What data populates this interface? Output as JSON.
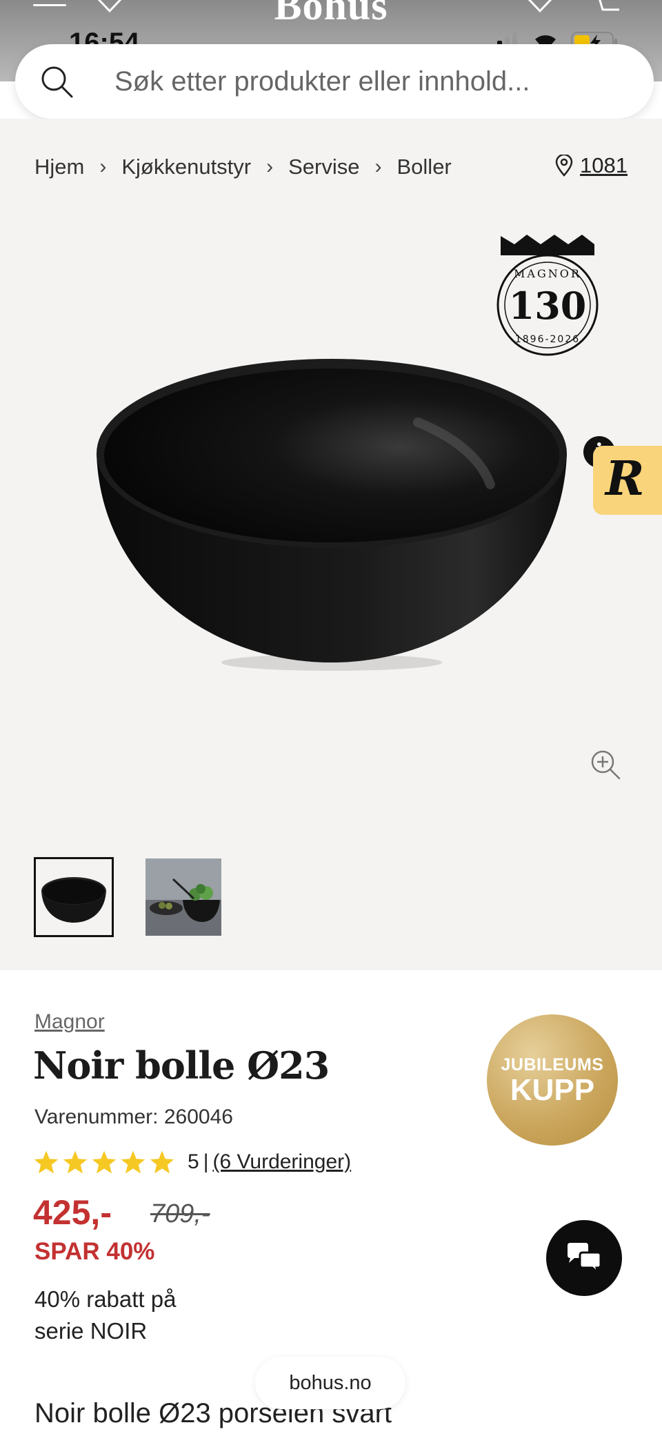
{
  "app": {
    "brand": "Bohus"
  },
  "status_bar": {
    "time": "16:54"
  },
  "search": {
    "placeholder": "Søk etter produkter eller innhold..."
  },
  "breadcrumb": {
    "items": [
      "Hjem",
      "Kjøkkenutstyr",
      "Servise",
      "Boller"
    ]
  },
  "store": {
    "label": "1081"
  },
  "badge": {
    "brand": "MAGNOR",
    "number": "130",
    "years": "1896-2026"
  },
  "product": {
    "brand": "Magnor",
    "title": "Noir bolle Ø23",
    "sku": "Varenummer: 260046",
    "rating_score": "5",
    "rating_separator": "|",
    "reviews": "(6 Vurderinger)",
    "stars": 5,
    "price": "425,-",
    "old_price": "709,-",
    "save": "SPAR 40%",
    "promo": "40% rabatt på serie NOIR",
    "description_start": "Noir bolle Ø23 porselen svart"
  },
  "kupp_badge": {
    "line1": "JUBILEUMS",
    "line2": "KUPP"
  },
  "site_pill": {
    "label": "bohus.no"
  },
  "colors": {
    "price_red": "#c33131",
    "star_yellow": "#f6c823",
    "gallery_bg": "#f4f3f2",
    "r_tab": "#f9d47a",
    "kupp_gold": "#c9a45a"
  },
  "icons": {
    "search": "search-icon",
    "location": "location-pin-icon",
    "zoom": "zoom-in-icon",
    "chat": "chat-icon",
    "info": "info-icon"
  }
}
